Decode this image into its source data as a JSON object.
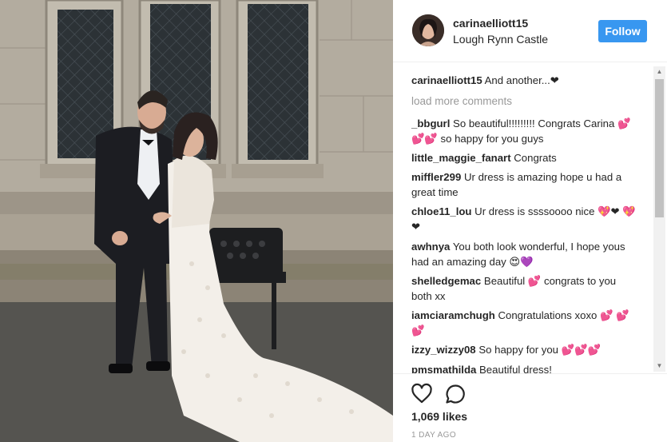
{
  "post": {
    "username": "carinaelliott15",
    "location": "Lough Rynn Castle",
    "follow_label": "Follow"
  },
  "caption": {
    "user": "carinaelliott15",
    "text": "And another...❤"
  },
  "load_more_label": "load more comments",
  "comments": [
    {
      "user": "_bbgurl",
      "text": "So beautiful!!!!!!!!! Congrats Carina 💕💕💕 so happy for you guys"
    },
    {
      "user": "little_maggie_fanart",
      "text": "Congrats"
    },
    {
      "user": "miffler299",
      "text": "Ur dress is amazing hope u had a great time"
    },
    {
      "user": "chloe11_lou",
      "text": "Ur dress is ssssoooo nice 💖❤ 💖❤"
    },
    {
      "user": "awhnya",
      "text": "You both look wonderful, I hope yous had an amazing day 😍💜"
    },
    {
      "user": "shelledgemac",
      "text": "Beautiful 💕 congrats to you both xx"
    },
    {
      "user": "iamciaramchugh",
      "text": "Congratulations xoxo 💕 💕💕"
    },
    {
      "user": "izzy_wizzy08",
      "text": "So happy for you 💕💕💕"
    },
    {
      "user": "pmsmathilda",
      "text": "Beautiful dress!"
    }
  ],
  "likes_text": "1,069 likes",
  "date_text": "1 DAY AGO",
  "icons": {
    "like": "heart-outline-icon",
    "comment": "speech-bubble-icon",
    "scroll_up": "arrow-up-icon",
    "scroll_down": "arrow-down-icon"
  },
  "colors": {
    "follow_button": "#3897f0",
    "muted_text": "#999999",
    "text": "#262626"
  }
}
